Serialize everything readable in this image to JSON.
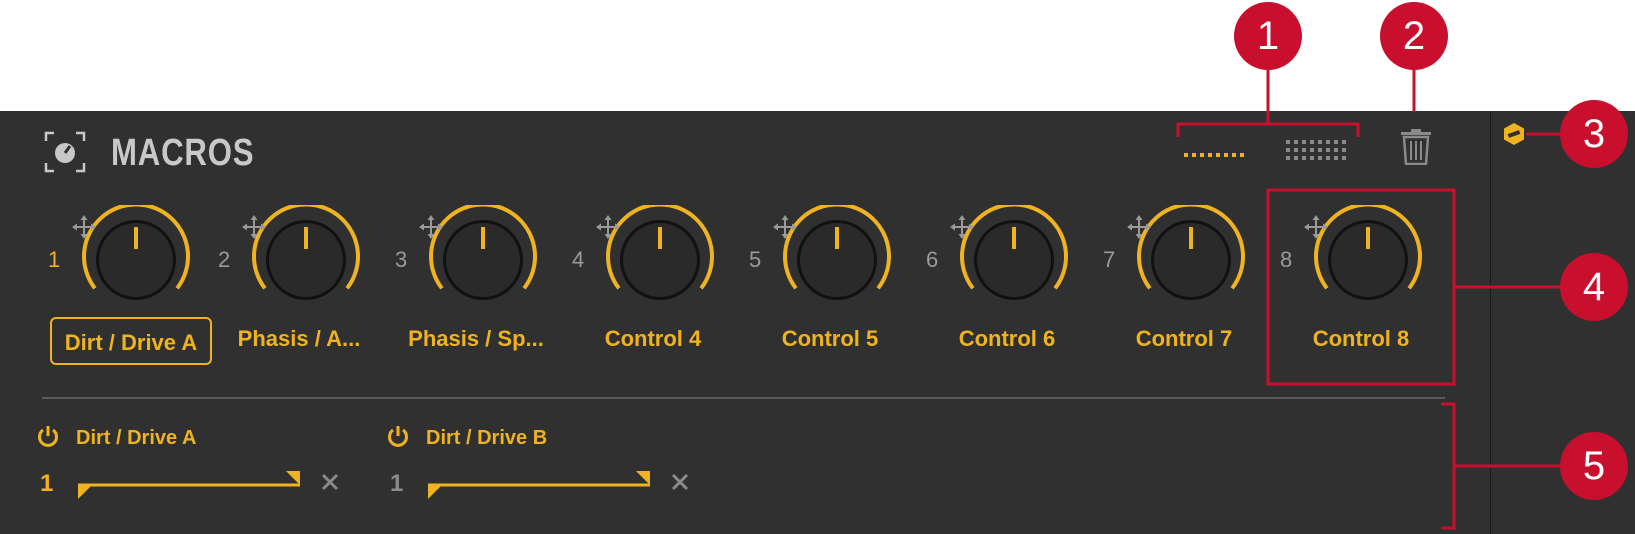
{
  "header": {
    "title": "MACROS",
    "icons": {
      "panel": "macro-knob-icon",
      "small_page": "small-view-icon",
      "large_page": "large-view-icon",
      "delete": "trash-icon",
      "right_side": "hex-nut-icon"
    }
  },
  "macros": [
    {
      "number": "1",
      "label": "Dirt / Drive A",
      "selected": true,
      "active": true
    },
    {
      "number": "2",
      "label": "Phasis / A...",
      "selected": false,
      "active": false
    },
    {
      "number": "3",
      "label": "Phasis / Sp...",
      "selected": false,
      "active": false
    },
    {
      "number": "4",
      "label": "Control 4",
      "selected": false,
      "active": false
    },
    {
      "number": "5",
      "label": "Control 5",
      "selected": false,
      "active": false
    },
    {
      "number": "6",
      "label": "Control 6",
      "selected": false,
      "active": false
    },
    {
      "number": "7",
      "label": "Control 7",
      "selected": false,
      "active": false
    },
    {
      "number": "8",
      "label": "Control 8",
      "selected": false,
      "active": false
    }
  ],
  "assignments": [
    {
      "name": "Dirt / Drive A",
      "index": "1",
      "active": true
    },
    {
      "name": "Dirt / Drive B",
      "index": "1",
      "active": false
    }
  ],
  "callouts": [
    "1",
    "2",
    "3",
    "4",
    "5"
  ],
  "colors": {
    "accent": "#f0b320",
    "panel_bg": "#303030",
    "callout": "#c8102e",
    "inactive_text": "#9a9a9a"
  }
}
